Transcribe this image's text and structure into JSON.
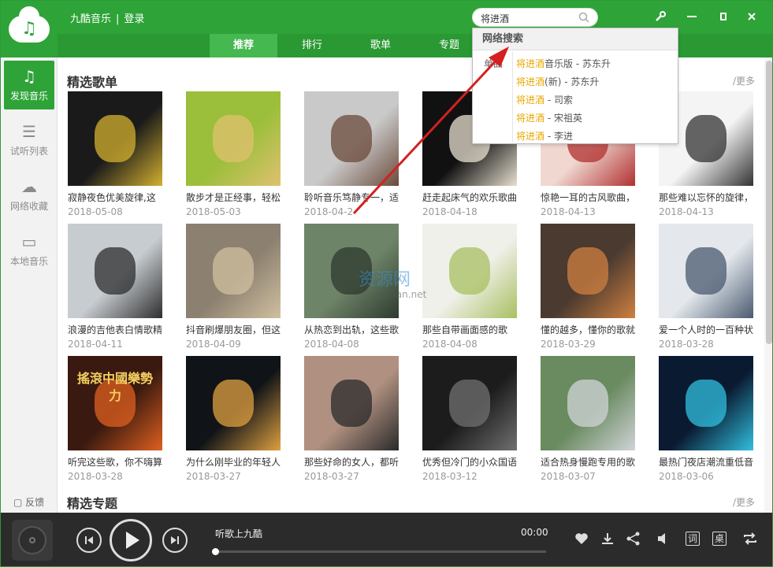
{
  "app": {
    "name": "九酷音乐",
    "separator": "|",
    "login": "登录"
  },
  "search": {
    "value": "将进酒",
    "placeholder": ""
  },
  "window_controls": {
    "tools": "tools-icon",
    "minimize": "minimize-icon",
    "restore": "restore-icon",
    "close": "close-icon"
  },
  "tabs": [
    {
      "label": "推荐",
      "active": true
    },
    {
      "label": "排行",
      "active": false
    },
    {
      "label": "歌单",
      "active": false
    },
    {
      "label": "专题",
      "active": false
    }
  ],
  "sidebar": {
    "items": [
      {
        "label": "发现音乐",
        "icon": "music-note-icon",
        "active": true
      },
      {
        "label": "试听列表",
        "icon": "list-icon",
        "active": false
      },
      {
        "label": "网络收藏",
        "icon": "cloud-icon",
        "active": false
      },
      {
        "label": "本地音乐",
        "icon": "monitor-icon",
        "active": false
      }
    ],
    "feedback": "反馈"
  },
  "sections": {
    "playlists_title": "精选歌单",
    "topics_title": "精选专题",
    "more": "/更多"
  },
  "playlists": [
    {
      "title": "寂静夜色优美旋律,这",
      "date": "2018-05-08"
    },
    {
      "title": "散步才是正经事，轻松",
      "date": "2018-05-03"
    },
    {
      "title": "聆听音乐笃静专一，适",
      "date": "2018-04-2"
    },
    {
      "title": "赶走起床气的欢乐歌曲",
      "date": "2018-04-18"
    },
    {
      "title": "惊艳一耳的古风歌曲，",
      "date": "2018-04-13"
    },
    {
      "title": "那些难以忘怀的旋律，",
      "date": "2018-04-13"
    },
    {
      "title": "浪漫的吉他表白情歌精",
      "date": "2018-04-11"
    },
    {
      "title": "抖音刷爆朋友圈，但这",
      "date": "2018-04-09"
    },
    {
      "title": "从热恋到出轨，这些歌",
      "date": "2018-04-08"
    },
    {
      "title": "那些自带画面感的歌",
      "date": "2018-04-08"
    },
    {
      "title": "懂的越多，懂你的歌就",
      "date": "2018-03-29"
    },
    {
      "title": "爱一个人时的一百种状",
      "date": "2018-03-28"
    },
    {
      "title": "听完这些歌，你不嗨算",
      "date": "2018-03-28"
    },
    {
      "title": "为什么刚毕业的年轻人",
      "date": "2018-03-27"
    },
    {
      "title": "那些好命的女人，都听",
      "date": "2018-03-27"
    },
    {
      "title": "优秀但冷门的小众国语",
      "date": "2018-03-12"
    },
    {
      "title": "适合热身慢跑专用的歌",
      "date": "2018-03-07"
    },
    {
      "title": "最热门夜店潮流重低音",
      "date": "2018-03-06"
    }
  ],
  "cover_art": {
    "text": "搖滾中國樂勢力"
  },
  "dropdown": {
    "header": "网络搜索",
    "category": "单曲",
    "results": [
      {
        "hl": "将进酒",
        "rest": "音乐版 - 苏东升"
      },
      {
        "hl": "将进酒",
        "rest": "(新) - 苏东升"
      },
      {
        "hl": "将进酒",
        "rest": " - 司索"
      },
      {
        "hl": "将进酒",
        "rest": " - 宋祖英"
      },
      {
        "hl": "将进酒",
        "rest": " - 李进"
      }
    ]
  },
  "watermark": {
    "text": "资源网",
    "sub": "nchan.net"
  },
  "player": {
    "now_playing": "听歌上九酷",
    "time": "00:00",
    "progress": 0,
    "box_lyrics": "词",
    "box_desktop": "桌"
  },
  "colors": {
    "brand": "#2ea338",
    "highlight": "#e8a800",
    "annotation_arrow": "#d42020"
  }
}
